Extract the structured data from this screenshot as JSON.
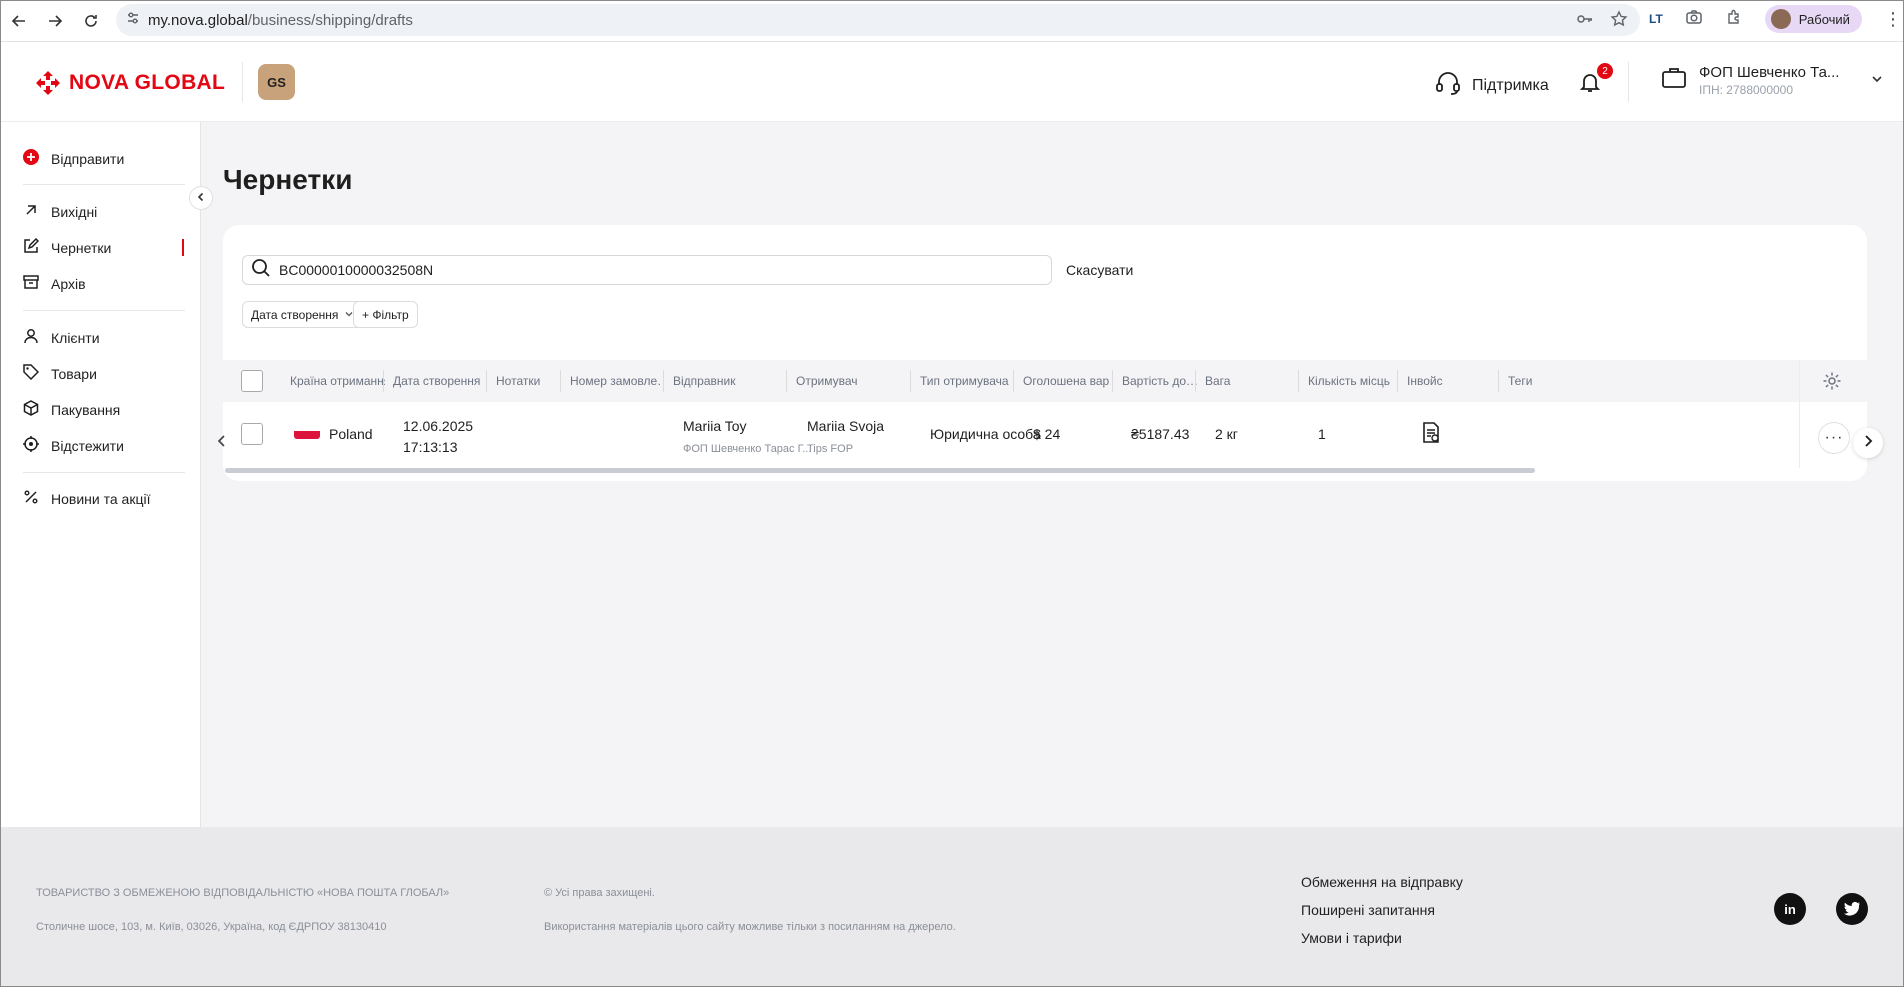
{
  "browser": {
    "url_host": "my.nova.global",
    "url_path": "/business/shipping/drafts",
    "profile_label": "Рабочий"
  },
  "header": {
    "brand": "NOVA GLOBAL",
    "badge": "GS",
    "support_label": "Підтримка",
    "notifications_count": "2",
    "account_name": "ФОП Шевченко Та...",
    "account_tax_id": "ІПН: 2788000000"
  },
  "sidebar": {
    "send": "Відправити",
    "outgoing": "Вихідні",
    "drafts": "Чернетки",
    "archive": "Архів",
    "clients": "Клієнти",
    "goods": "Товари",
    "packaging": "Пакування",
    "track": "Відстежити",
    "news": "Новини та акції"
  },
  "page": {
    "title": "Чернетки",
    "search_value": "BC0000010000032508N",
    "cancel_label": "Скасувати",
    "filter_date": "Дата створення",
    "filter_add": "+ Фільтр"
  },
  "table": {
    "columns": [
      "Країна отримання",
      "Дата створення",
      "Нотатки",
      "Номер замовле…",
      "Відправник",
      "Отримувач",
      "Тип отримувача",
      "Оголошена вар…",
      "Вартість до…",
      "Вага",
      "Кількість місць",
      "Інвойс",
      "Теги"
    ],
    "rows": [
      {
        "country": "Poland",
        "date": "12.06.2025",
        "time": "17:13:13",
        "sender_name": "Mariia Toy",
        "sender_company": "ФОП Шевченко Тарас Г...",
        "recipient_name": "Mariia Svoja",
        "recipient_company": "Tips FOP",
        "recipient_type": "Юридична особа",
        "declared_value": "$ 24",
        "delivery_cost": "₴5187.43",
        "weight": "2 кг",
        "places": "1"
      }
    ]
  },
  "footer": {
    "company": "ТОВАРИСТВО З ОБМЕЖЕНОЮ ВІДПОВІДАЛЬНІСТЮ «НОВА ПОШТА ГЛОБАЛ»",
    "address": "Столичне шосе, 103, м. Київ, 03026, Україна, код ЄДРПОУ 38130410",
    "rights": "© Усі права захищені.",
    "usage": "Використання матеріалів цього сайту можливе тільки з посиланням на джерело.",
    "link_restrictions": "Обмеження на відправку",
    "link_faq": "Поширені запитання",
    "link_terms": "Умови і тарифи",
    "social_linkedin": "in"
  },
  "colors": {
    "brand_red": "#e30613",
    "page_bg": "#f4f4f6",
    "profile_chip": "#e7d9f6"
  }
}
